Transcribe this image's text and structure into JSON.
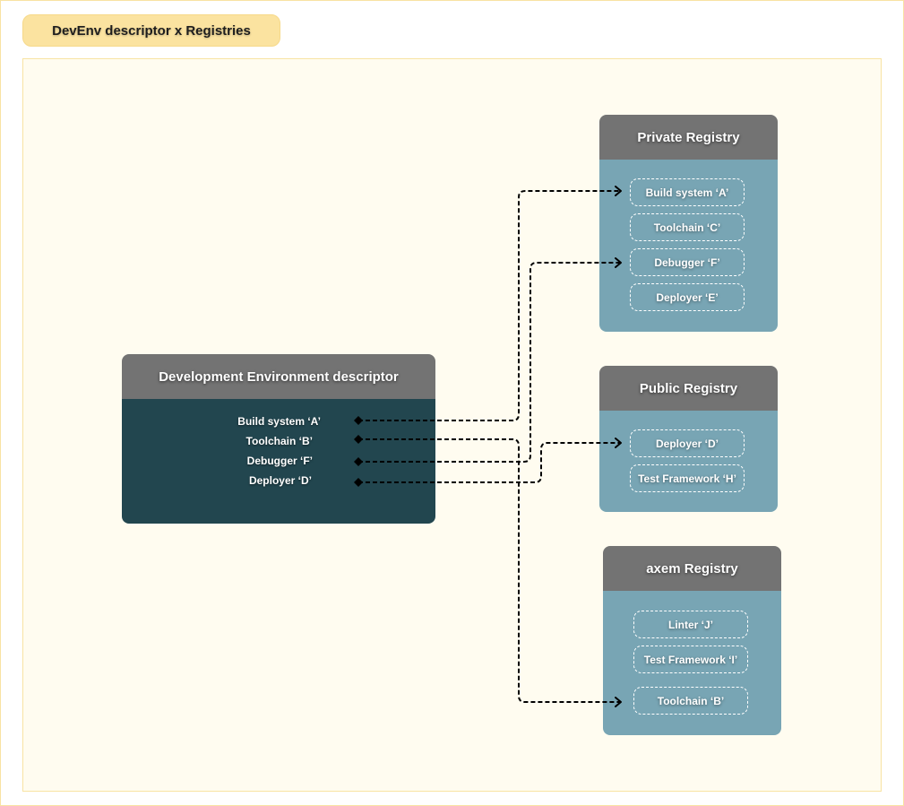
{
  "title": "DevEnv descriptor x Registries",
  "descriptor": {
    "title": "Development Environment descriptor",
    "items": [
      {
        "label": "Build system ‘A’"
      },
      {
        "label": "Toolchain ‘B’"
      },
      {
        "label": "Debugger ‘F’"
      },
      {
        "label": "Deployer ‘D’"
      }
    ]
  },
  "registries": [
    {
      "title": "Private Registry",
      "items": [
        {
          "label": "Build system ‘A’"
        },
        {
          "label": "Toolchain ‘C’"
        },
        {
          "label": "Debugger ‘F’"
        },
        {
          "label": "Deployer ‘E’"
        }
      ]
    },
    {
      "title": "Public Registry",
      "items": [
        {
          "label": "Deployer ‘D’"
        },
        {
          "label": "Test Framework ‘H’"
        }
      ]
    },
    {
      "title": "axem Registry",
      "items": [
        {
          "label": "Linter ‘J’"
        },
        {
          "label": "Test Framework ‘I’"
        },
        {
          "label": "Toolchain ‘B’"
        }
      ]
    }
  ],
  "connections": [
    {
      "from": "descriptor.items.0",
      "to": "registries.0.items.0"
    },
    {
      "from": "descriptor.items.1",
      "to": "registries.2.items.2"
    },
    {
      "from": "descriptor.items.2",
      "to": "registries.0.items.2"
    },
    {
      "from": "descriptor.items.3",
      "to": "registries.1.items.0"
    }
  ],
  "colors": {
    "title_pill": "#fbe3a0",
    "canvas": "#fffcf0",
    "header": "#737373",
    "descriptor_body": "#22464f",
    "registry_body": "#78a5b4",
    "connector": "#000000"
  }
}
